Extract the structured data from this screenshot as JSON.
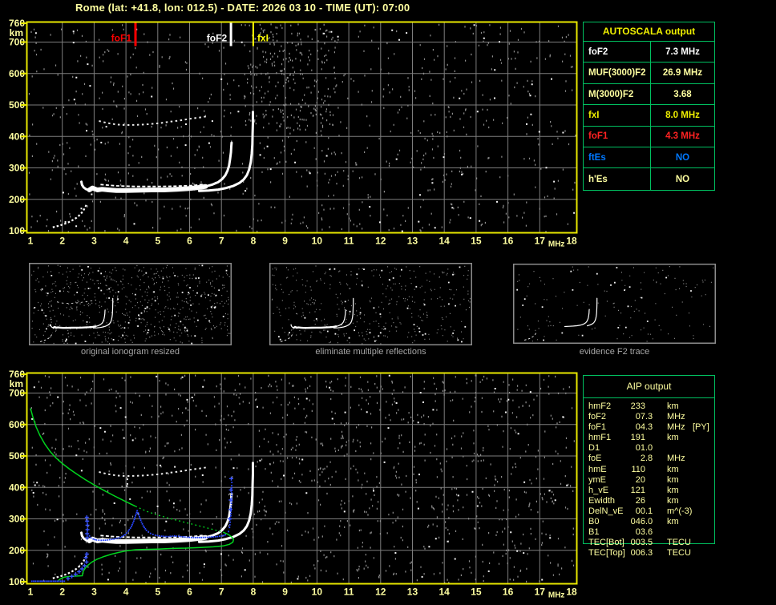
{
  "title": "Rome (lat: +41.8, lon: 012.5) - DATE: 2026 03 10 - TIME (UT): 07:00",
  "colors": {
    "background": "#000000",
    "axis_text": "#ffffa0",
    "plot_border": "#e8e800",
    "grid": "#7d7d7d",
    "table_border": "#00c060",
    "profile_green": "#00d41e",
    "restored_trace_blue": "#2846ff",
    "echo_white": "#ffffff",
    "speckle_gray": "#8e8e8e",
    "thumb_border": "#8c8c8c",
    "thumb_label": "#a6a6a6"
  },
  "autoscala_table": {
    "title": "AUTOSCALA output",
    "rows": [
      {
        "label": "foF2",
        "value": "7.3 MHz",
        "color": "#ffffff"
      },
      {
        "label": "MUF(3000)F2",
        "value": "26.9 MHz",
        "color": "#ffffa0"
      },
      {
        "label": "M(3000)F2",
        "value": "3.68",
        "color": "#ffffa0"
      },
      {
        "label": "fxI",
        "value": "8.0 MHz",
        "color": "#f0f000"
      },
      {
        "label": "foF1",
        "value": "4.3 MHz",
        "color": "#ff2222"
      },
      {
        "label": "ftEs",
        "value": "NO",
        "color": "#0078ff"
      },
      {
        "label": "h'Es",
        "value": "NO",
        "color": "#ffffa0"
      }
    ]
  },
  "aip_table": {
    "title": "AIP output",
    "rows": [
      {
        "label": "hmF2",
        "value": "233",
        "unit": "km",
        "note": ""
      },
      {
        "label": "foF2",
        "value": "07.3",
        "unit": "MHz",
        "note": ""
      },
      {
        "label": "foF1",
        "value": "04.3",
        "unit": "MHz",
        "note": "[PY]"
      },
      {
        "label": "hmF1",
        "value": "191",
        "unit": "km",
        "note": ""
      },
      {
        "label": "D1",
        "value": "01.0",
        "unit": "",
        "note": ""
      },
      {
        "label": "foE",
        "value": "2.8",
        "unit": "MHz",
        "note": ""
      },
      {
        "label": "hmE",
        "value": "110",
        "unit": "km",
        "note": ""
      },
      {
        "label": "ymE",
        "value": "20",
        "unit": "km",
        "note": ""
      },
      {
        "label": "h_vE",
        "value": "121",
        "unit": "km",
        "note": ""
      },
      {
        "label": "Ewidth",
        "value": "26",
        "unit": "km",
        "note": ""
      },
      {
        "label": "DelN_vE",
        "value": "00.1",
        "unit": "m^(-3)",
        "note": ""
      },
      {
        "label": "B0",
        "value": "046.0",
        "unit": "km",
        "note": ""
      },
      {
        "label": "B1",
        "value": "03.6",
        "unit": "",
        "note": ""
      },
      {
        "label": "TEC[Bot]",
        "value": "003.5",
        "unit": "TECU",
        "note": ""
      },
      {
        "label": "TEC[Top]",
        "value": "006.3",
        "unit": "TECU",
        "note": ""
      }
    ]
  },
  "thumbnails": [
    {
      "label": "original ionogram resized"
    },
    {
      "label": "eliminate multiple reflections"
    },
    {
      "label": "evidence F2 trace"
    }
  ],
  "chart_data": {
    "type": "scatter",
    "title": "Ionogram, Rome, 2026 03 10 07:00 UT",
    "xlabel": "MHz",
    "ylabel": "km",
    "xlim": [
      1,
      18
    ],
    "ylim": [
      100,
      760
    ],
    "grid": true,
    "x_ticks": [
      1,
      2,
      3,
      4,
      5,
      6,
      7,
      8,
      9,
      10,
      11,
      12,
      13,
      14,
      15,
      16,
      17,
      18
    ],
    "y_ticks": [
      760,
      700,
      600,
      500,
      400,
      300,
      200,
      100
    ],
    "markers": [
      {
        "label": "foF1",
        "freq": 4.3,
        "color": "#ff0000",
        "label_side": "left"
      },
      {
        "label": "foF2",
        "freq": 7.3,
        "color": "#ffffff",
        "label_side": "left"
      },
      {
        "label": "fxI",
        "freq": 8.0,
        "color": "#ffff00",
        "label_side": "right"
      }
    ],
    "ionogram_traces": {
      "f_main": [
        [
          2.6,
          256
        ],
        [
          2.62,
          246
        ],
        [
          2.67,
          238
        ],
        [
          2.75,
          232
        ],
        [
          2.85,
          230
        ],
        [
          2.95,
          236
        ],
        [
          3.1,
          230
        ],
        [
          3.25,
          232
        ],
        [
          3.45,
          230
        ],
        [
          3.7,
          228
        ],
        [
          4.0,
          228
        ],
        [
          4.4,
          229
        ],
        [
          4.8,
          230
        ],
        [
          5.2,
          230
        ],
        [
          5.6,
          232
        ],
        [
          5.95,
          234
        ],
        [
          6.25,
          237
        ],
        [
          6.5,
          241
        ],
        [
          6.72,
          247
        ],
        [
          6.9,
          255
        ],
        [
          7.02,
          264
        ],
        [
          7.12,
          276
        ],
        [
          7.19,
          291
        ],
        [
          7.24,
          308
        ],
        [
          7.27,
          328
        ],
        [
          7.3,
          350
        ],
        [
          7.31,
          368
        ],
        [
          7.32,
          380
        ]
      ],
      "band_upper": [
        [
          3.2,
          247
        ],
        [
          3.7,
          243
        ],
        [
          4.3,
          241
        ],
        [
          5.0,
          241
        ],
        [
          5.6,
          242
        ],
        [
          6.1,
          244
        ],
        [
          6.45,
          248
        ]
      ],
      "f_xmode": [
        [
          6.3,
          227
        ],
        [
          6.6,
          228
        ],
        [
          6.9,
          231
        ],
        [
          7.15,
          236
        ],
        [
          7.38,
          243
        ],
        [
          7.56,
          252
        ],
        [
          7.7,
          263
        ],
        [
          7.8,
          277
        ],
        [
          7.87,
          295
        ],
        [
          7.92,
          318
        ],
        [
          7.95,
          345
        ],
        [
          7.97,
          375
        ],
        [
          7.98,
          410
        ],
        [
          7.99,
          445
        ],
        [
          7.99,
          478
        ]
      ],
      "second_reflection": [
        [
          3.15,
          449
        ],
        [
          3.4,
          443
        ],
        [
          3.7,
          438
        ],
        [
          4.0,
          436
        ],
        [
          4.35,
          437
        ],
        [
          4.7,
          439
        ],
        [
          5.05,
          442
        ],
        [
          5.4,
          447
        ],
        [
          5.7,
          451
        ],
        [
          6.0,
          456
        ],
        [
          6.3,
          460
        ],
        [
          6.55,
          464
        ]
      ],
      "e_layer": [
        [
          1.7,
          111
        ],
        [
          1.9,
          116
        ],
        [
          2.1,
          123
        ],
        [
          2.28,
          131
        ],
        [
          2.44,
          141
        ],
        [
          2.57,
          152
        ],
        [
          2.66,
          164
        ],
        [
          2.73,
          177
        ],
        [
          2.78,
          188
        ]
      ]
    },
    "profile_green": {
      "solid_upper": [
        [
          1.0,
          652
        ],
        [
          1.08,
          622
        ],
        [
          1.18,
          592
        ],
        [
          1.3,
          565
        ],
        [
          1.45,
          538
        ],
        [
          1.62,
          514
        ],
        [
          1.8,
          494
        ],
        [
          2.0,
          476
        ],
        [
          2.22,
          459
        ],
        [
          2.46,
          442
        ],
        [
          2.72,
          425
        ],
        [
          3.0,
          408
        ],
        [
          3.3,
          391
        ],
        [
          3.62,
          374
        ],
        [
          3.95,
          357
        ],
        [
          4.3,
          340
        ]
      ],
      "dashed_mid": [
        [
          4.3,
          340
        ],
        [
          4.65,
          324
        ],
        [
          5.0,
          312
        ],
        [
          5.35,
          302
        ],
        [
          5.7,
          293
        ],
        [
          6.05,
          284
        ],
        [
          6.4,
          275
        ],
        [
          6.75,
          266
        ],
        [
          7.05,
          258
        ]
      ],
      "solid_lower": [
        [
          7.05,
          258
        ],
        [
          7.22,
          250
        ],
        [
          7.33,
          242
        ],
        [
          7.38,
          234
        ],
        [
          7.36,
          226
        ],
        [
          7.25,
          219
        ],
        [
          7.05,
          214
        ],
        [
          6.75,
          211
        ],
        [
          6.35,
          209
        ],
        [
          5.9,
          207
        ],
        [
          5.45,
          206
        ],
        [
          5.0,
          204
        ],
        [
          4.6,
          203
        ],
        [
          4.3,
          202
        ],
        [
          4.05,
          199
        ],
        [
          3.8,
          194
        ],
        [
          3.55,
          188
        ],
        [
          3.3,
          180
        ],
        [
          3.08,
          171
        ],
        [
          2.92,
          162
        ],
        [
          2.8,
          152
        ],
        [
          2.72,
          143
        ],
        [
          2.66,
          134
        ],
        [
          2.64,
          126
        ],
        [
          2.63,
          119
        ],
        [
          2.45,
          118
        ],
        [
          2.25,
          117
        ],
        [
          2.08,
          115
        ],
        [
          1.97,
          111
        ],
        [
          1.9,
          106
        ],
        [
          1.88,
          102
        ]
      ]
    },
    "blue_restored_trace": {
      "bottom_row": [
        [
          1.02,
          104
        ],
        [
          2.1,
          104
        ]
      ],
      "main": [
        [
          2.83,
          248
        ],
        [
          2.88,
          242
        ],
        [
          2.95,
          238
        ],
        [
          3.05,
          235
        ],
        [
          3.2,
          234
        ],
        [
          3.4,
          235
        ],
        [
          3.6,
          238
        ],
        [
          3.8,
          243
        ],
        [
          3.95,
          252
        ],
        [
          4.05,
          263
        ],
        [
          4.15,
          278
        ],
        [
          4.22,
          295
        ],
        [
          4.28,
          312
        ],
        [
          4.33,
          328
        ],
        [
          4.38,
          315
        ],
        [
          4.44,
          298
        ],
        [
          4.52,
          280
        ],
        [
          4.62,
          266
        ],
        [
          4.75,
          256
        ],
        [
          4.9,
          250
        ],
        [
          5.1,
          247
        ],
        [
          5.3,
          246
        ],
        [
          5.5,
          248
        ],
        [
          5.7,
          246
        ],
        [
          5.9,
          244
        ],
        [
          6.1,
          243
        ],
        [
          6.35,
          243
        ],
        [
          6.6,
          244
        ],
        [
          6.85,
          246
        ],
        [
          7.05,
          249
        ],
        [
          7.15,
          254
        ]
      ],
      "riser": [
        [
          7.2,
          262
        ],
        [
          7.23,
          275
        ],
        [
          7.25,
          292
        ],
        [
          7.27,
          312
        ],
        [
          7.28,
          335
        ],
        [
          7.29,
          360
        ],
        [
          7.3,
          385
        ],
        [
          7.3,
          408
        ],
        [
          7.31,
          428
        ]
      ],
      "crosses": [
        [
          2.18,
          110
        ],
        [
          2.3,
          117
        ],
        [
          2.42,
          124
        ],
        [
          2.53,
          132
        ],
        [
          2.62,
          141
        ],
        [
          2.7,
          151
        ],
        [
          2.76,
          163
        ],
        [
          2.74,
          177
        ],
        [
          2.77,
          188
        ],
        [
          2.78,
          240
        ],
        [
          2.78,
          253
        ],
        [
          2.79,
          266
        ],
        [
          2.79,
          280
        ],
        [
          2.78,
          293
        ],
        [
          2.77,
          305
        ],
        [
          7.26,
          300
        ],
        [
          7.28,
          330
        ],
        [
          7.29,
          360
        ],
        [
          7.3,
          392
        ],
        [
          7.31,
          428
        ]
      ]
    }
  }
}
